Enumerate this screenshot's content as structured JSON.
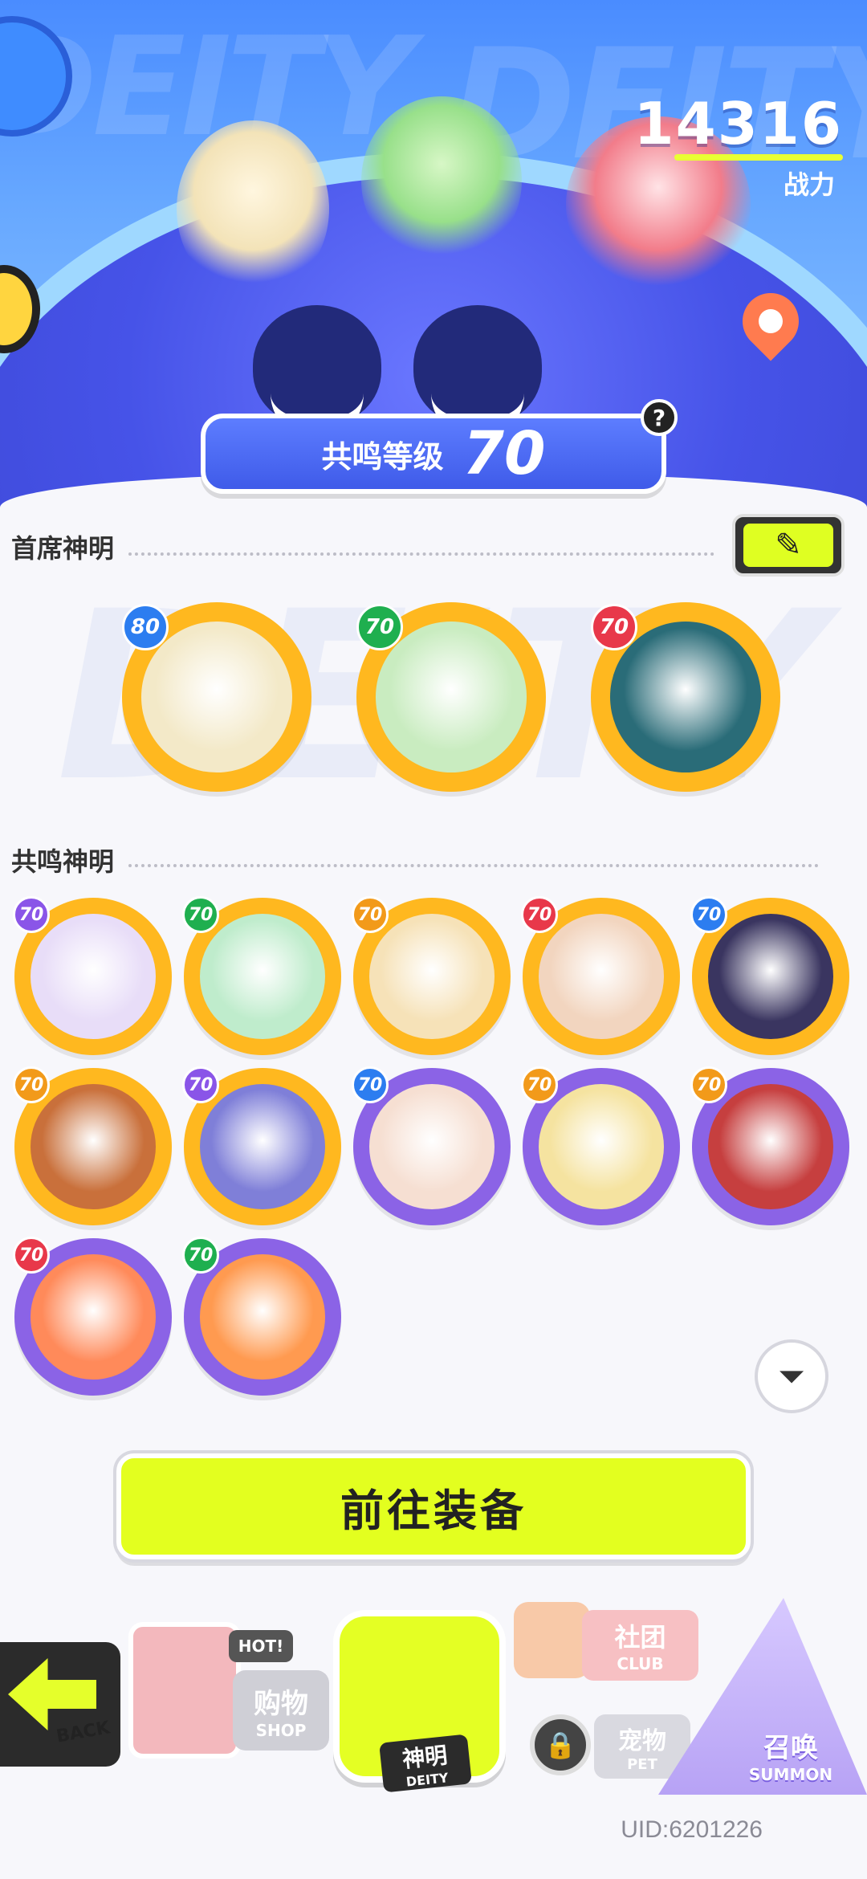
{
  "power": {
    "value": "14316",
    "label": "战力"
  },
  "banner": {
    "watermark": "DEITY"
  },
  "resonance": {
    "label": "共鸣等级",
    "level": "70",
    "help_icon": "?"
  },
  "sections": {
    "chief": {
      "title": "首席神明",
      "edit_icon": "edit-pencil"
    },
    "resonant": {
      "title": "共鸣神明"
    }
  },
  "chief_deities": [
    {
      "level": "80",
      "badge_color": "#2c7df0",
      "frame_color": "#ffb81f",
      "face_color": "#f3e9c8"
    },
    {
      "level": "70",
      "badge_color": "#1faf4f",
      "frame_color": "#ffb81f",
      "face_color": "#c9ecc0"
    },
    {
      "level": "70",
      "badge_color": "#e8384a",
      "frame_color": "#ffb81f",
      "face_color": "#2a6c78"
    }
  ],
  "resonant_deities": [
    {
      "level": "70",
      "badge_color": "#8a55e8",
      "frame_color": "#ffb81f",
      "face_color": "#e8ddf8"
    },
    {
      "level": "70",
      "badge_color": "#1faf4f",
      "frame_color": "#ffb81f",
      "face_color": "#bfeccc"
    },
    {
      "level": "70",
      "badge_color": "#f29a1a",
      "frame_color": "#ffb81f",
      "face_color": "#f6e2b8"
    },
    {
      "level": "70",
      "badge_color": "#e8384a",
      "frame_color": "#ffb81f",
      "face_color": "#f2d5bf"
    },
    {
      "level": "70",
      "badge_color": "#2c7df0",
      "frame_color": "#ffb81f",
      "face_color": "#3a3560"
    },
    {
      "level": "70",
      "badge_color": "#f29a1a",
      "frame_color": "#ffb81f",
      "face_color": "#c9703b"
    },
    {
      "level": "70",
      "badge_color": "#8a55e8",
      "frame_color": "#ffb81f",
      "face_color": "#7f7fd8"
    },
    {
      "level": "70",
      "badge_color": "#2c7df0",
      "frame_color": "#8b63e6",
      "face_color": "#f6dfd2"
    },
    {
      "level": "70",
      "badge_color": "#f29a1a",
      "frame_color": "#8b63e6",
      "face_color": "#f5e3a0"
    },
    {
      "level": "70",
      "badge_color": "#f29a1a",
      "frame_color": "#8b63e6",
      "face_color": "#c63f3f"
    },
    {
      "level": "70",
      "badge_color": "#e8384a",
      "frame_color": "#8b63e6",
      "face_color": "#ff8a5a"
    },
    {
      "level": "70",
      "badge_color": "#1faf4f",
      "frame_color": "#8b63e6",
      "face_color": "#ff9a50"
    }
  ],
  "actions": {
    "equip": "前往装备",
    "filter_icon": "filter"
  },
  "nav": {
    "back": "BACK",
    "shop_badge": "HOT!",
    "shop_cn": "购物",
    "shop_en": "SHOP",
    "deity_cn": "神明",
    "deity_en": "DEITY",
    "club_cn": "社团",
    "club_en": "CLUB",
    "pet_cn": "宠物",
    "pet_en": "PET",
    "summon_cn": "召唤",
    "summon_en": "SUMMON"
  },
  "uid": "UID:6201226"
}
